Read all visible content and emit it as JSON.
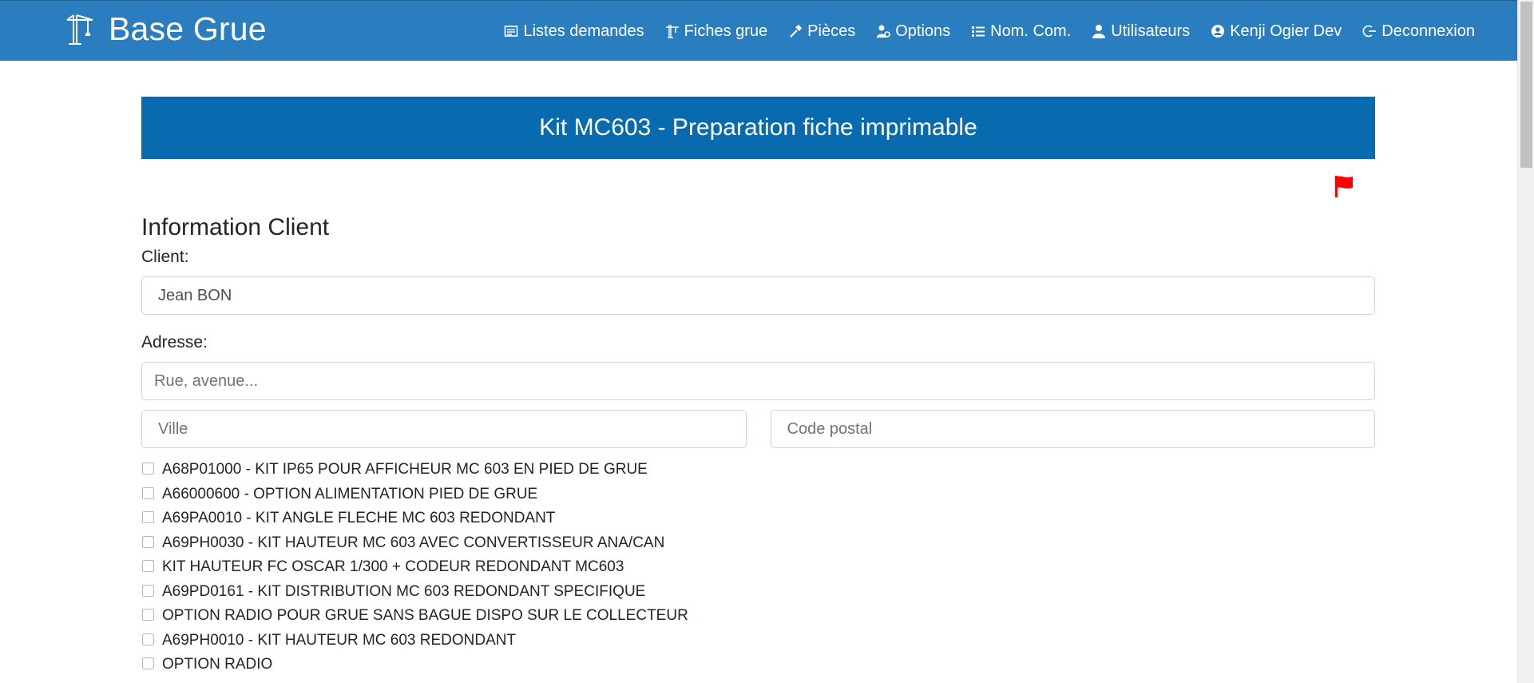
{
  "navbar": {
    "brand": "Base Grue",
    "brand_icon": "crane-icon",
    "items": [
      {
        "label": "Listes demandes",
        "icon": "list-alt-icon"
      },
      {
        "label": "Fiches grue",
        "icon": "crane-icon"
      },
      {
        "label": "Pièces",
        "icon": "hammer-icon"
      },
      {
        "label": "Options",
        "icon": "user-cog-icon"
      },
      {
        "label": "Nom. Com.",
        "icon": "list-icon"
      },
      {
        "label": "Utilisateurs",
        "icon": "user-icon"
      },
      {
        "label": "Kenji Ogier Dev",
        "icon": "user-circle-icon"
      },
      {
        "label": "Deconnexion",
        "icon": "logout-icon"
      }
    ],
    "color": "#2a7ebf"
  },
  "page": {
    "title": "Kit MC603 - Preparation fiche imprimable",
    "title_color": "#086bb0",
    "flag_icon": "flag-icon",
    "flag_color": "#ff0000"
  },
  "client": {
    "section_title": "Information Client",
    "client_label": "Client:",
    "client_value": "Jean BON",
    "address_label": "Adresse:",
    "address_placeholder": "Rue, avenue...",
    "city_placeholder": "Ville",
    "postal_placeholder": "Code postal"
  },
  "options": [
    "A68P01000 - KIT IP65 POUR AFFICHEUR MC 603 EN PIED DE GRUE",
    "A66000600 - OPTION ALIMENTATION PIED DE GRUE",
    "A69PA0010 - KIT ANGLE FLECHE MC 603 REDONDANT",
    "A69PH0030 - KIT HAUTEUR MC 603 AVEC CONVERTISSEUR ANA/CAN",
    "KIT HAUTEUR FC OSCAR 1/300 + CODEUR REDONDANT MC603",
    "A69PD0161 - KIT DISTRIBUTION MC 603 REDONDANT SPECIFIQUE",
    "OPTION RADIO POUR GRUE SANS BAGUE DISPO SUR LE COLLECTEUR",
    "A69PH0010 - KIT HAUTEUR MC 603 REDONDANT",
    "OPTION RADIO"
  ]
}
